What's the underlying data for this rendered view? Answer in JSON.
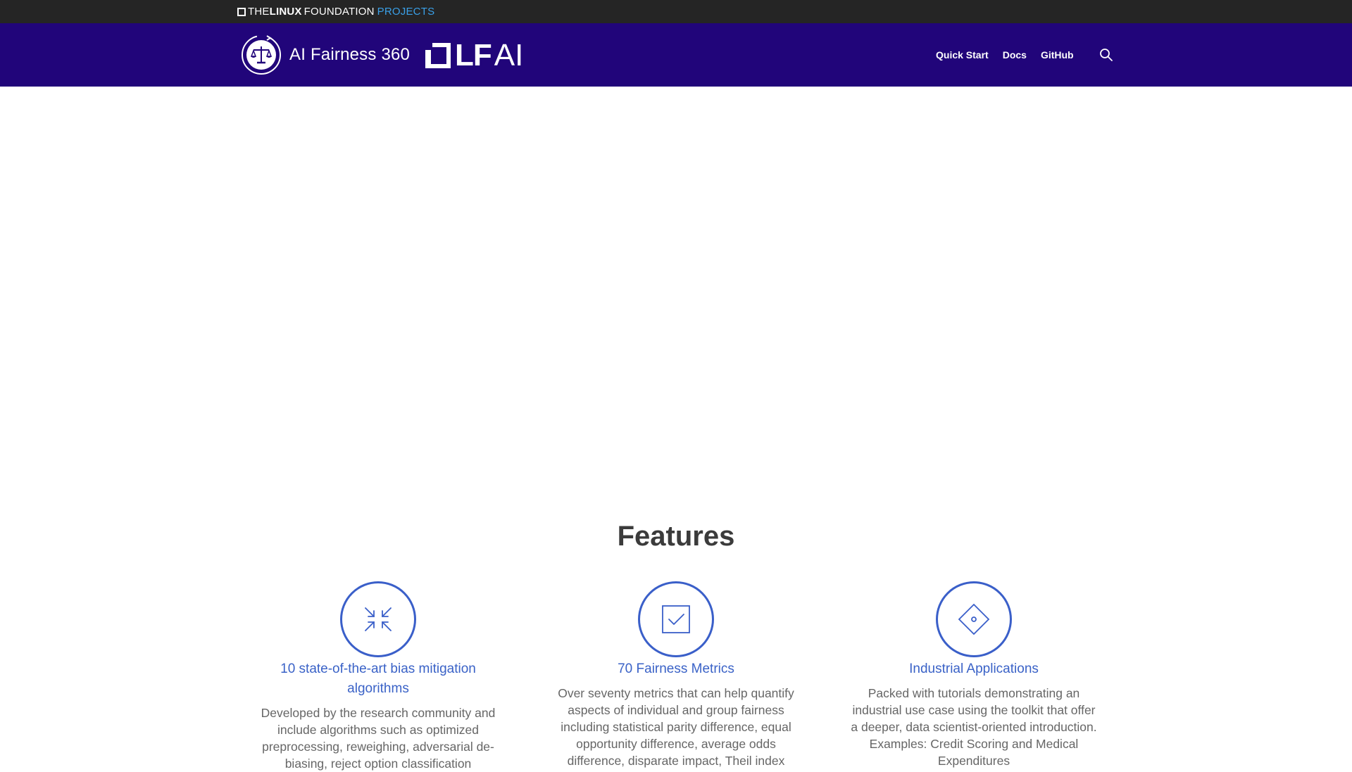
{
  "topbar": {
    "logo_the": "THE",
    "logo_linux": "LINUX",
    "logo_foundation": "FOUNDATION",
    "logo_projects": "PROJECTS"
  },
  "header": {
    "brand_title": "AI Fairness 360",
    "lfai_lf": "LF",
    "lfai_ai": "AI",
    "nav": [
      {
        "label": "Quick Start"
      },
      {
        "label": "Docs"
      },
      {
        "label": "GitHub"
      }
    ],
    "search_icon": "search-icon"
  },
  "features": {
    "heading": "Features",
    "items": [
      {
        "icon": "arrows-inward-icon",
        "title": "10 state-of-the-art bias mitigation algorithms",
        "description": "Developed by the research community and include algorithms such as optimized preprocessing, reweighing, adversarial de-biasing, reject option classification"
      },
      {
        "icon": "checkbox-icon",
        "title": "70 Fairness Metrics",
        "description": "Over seventy metrics that can help quantify aspects of individual and group fairness including statistical parity difference, equal opportunity difference, average odds difference, disparate impact, Theil index"
      },
      {
        "icon": "diamond-target-icon",
        "title": "Industrial Applications",
        "description": "Packed with tutorials demonstrating an industrial use case using the toolkit that offer a deeper, data scientist-oriented introduction. Examples: Credit Scoring and Medical Expenditures"
      }
    ]
  },
  "colors": {
    "topbar_bg": "#252525",
    "header_bg": "#21057a",
    "accent_blue": "#3a62c7",
    "projects_blue": "#3aa0e8",
    "heading_text": "#3b3b3b",
    "body_text": "#666666"
  }
}
